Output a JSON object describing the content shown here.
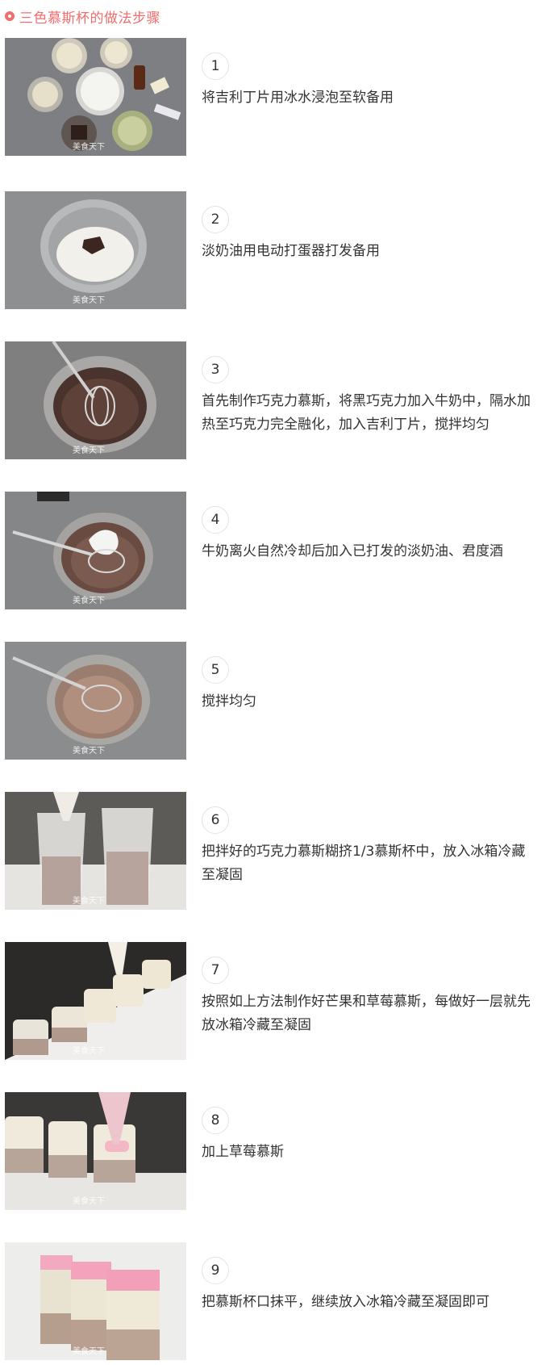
{
  "header": {
    "icon": "ring-icon",
    "title": "三色慕斯杯的做法步骤",
    "accent_color": "#f36d6d"
  },
  "watermark": "美食天下",
  "steps": [
    {
      "number": "1",
      "text": "将吉利丁片用冰水浸泡至软备用"
    },
    {
      "number": "2",
      "text": "淡奶油用电动打蛋器打发备用"
    },
    {
      "number": "3",
      "text": "首先制作巧克力慕斯，将黑巧克力加入牛奶中，隔水加热至巧克力完全融化，加入吉利丁片，搅拌均匀"
    },
    {
      "number": "4",
      "text": "牛奶离火自然冷却后加入已打发的淡奶油、君度酒"
    },
    {
      "number": "5",
      "text": "搅拌均匀"
    },
    {
      "number": "6",
      "text": "把拌好的巧克力慕斯糊挤1/3慕斯杯中，放入冰箱冷藏至凝固"
    },
    {
      "number": "7",
      "text": "按照如上方法制作好芒果和草莓慕斯，每做好一层就先放冰箱冷藏至凝固"
    },
    {
      "number": "8",
      "text": "加上草莓慕斯"
    },
    {
      "number": "9",
      "text": "把慕斯杯口抹平，继续放入冰箱冷藏至凝固即可"
    }
  ]
}
